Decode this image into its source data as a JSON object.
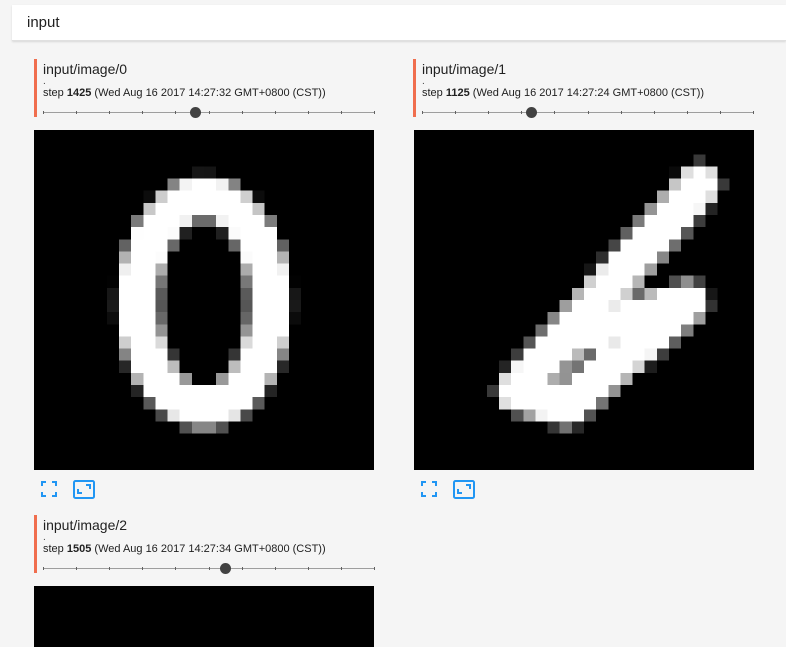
{
  "header": {
    "title": "input"
  },
  "cards": [
    {
      "title": "input/image/0",
      "dot": ".",
      "step_prefix": "step ",
      "step": "1425",
      "timestamp": "(Wed Aug 16 2017 14:27:32 GMT+0800 (CST))",
      "slider_fraction": 0.46,
      "digit": "0"
    },
    {
      "title": "input/image/1",
      "dot": ".",
      "step_prefix": "step ",
      "step": "1125",
      "timestamp": "(Wed Aug 16 2017 14:27:24 GMT+0800 (CST))",
      "slider_fraction": 0.33,
      "digit": "6"
    },
    {
      "title": "input/image/2",
      "dot": ".",
      "step_prefix": "step ",
      "step": "1505",
      "timestamp": "(Wed Aug 16 2017 14:27:34 GMT+0800 (CST))",
      "slider_fraction": 0.55,
      "digit": ""
    }
  ],
  "icons": [
    "fullscreen-icon",
    "actual-size-icon"
  ],
  "colors": {
    "accent": "#f06e4e",
    "icon_blue": "#2196f3"
  }
}
